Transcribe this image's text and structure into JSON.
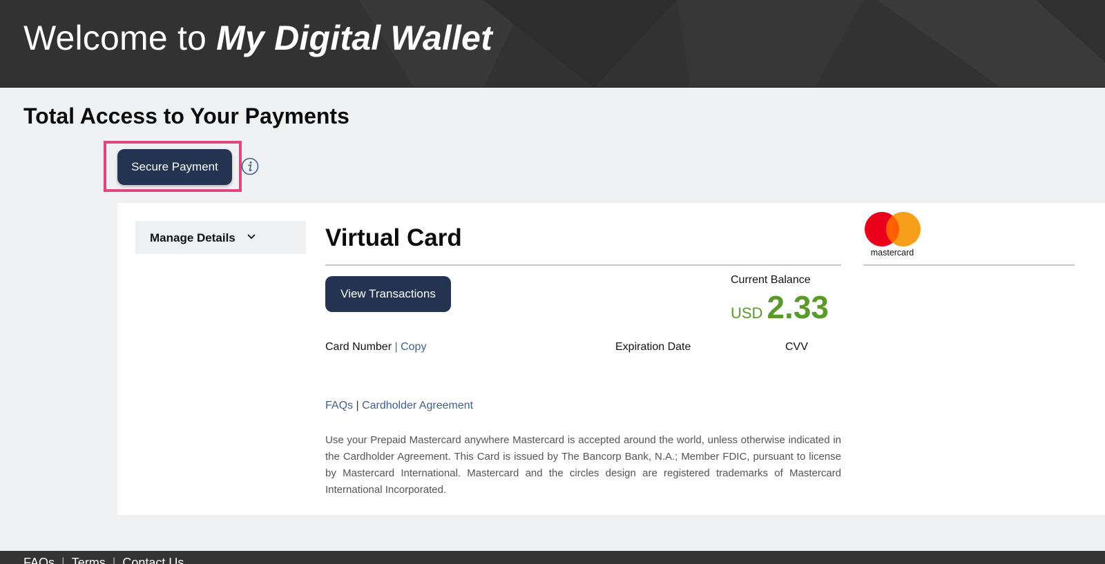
{
  "header": {
    "welcome_prefix": "Welcome to",
    "brand": "My Digital Wallet"
  },
  "page_title": "Total Access to Your Payments",
  "actions": {
    "secure_payment_label": "Secure Payment",
    "info_icon": "info-icon"
  },
  "sidebar": {
    "manage_details_label": "Manage Details",
    "chevron_icon": "chevron-down-icon"
  },
  "card": {
    "title": "Virtual Card",
    "view_transactions_label": "View Transactions",
    "balance_label": "Current Balance",
    "currency": "USD",
    "balance": "2.33",
    "card_number_label": "Card Number",
    "copy_link": "Copy",
    "expiration_label": "Expiration Date",
    "cvv_label": "CVV",
    "faqs_link": "FAQs",
    "cardholder_agreement_link": "Cardholder Agreement",
    "disclaimer": "Use your Prepaid Mastercard anywhere Mastercard is accepted around the world, unless otherwise indicated in the Cardholder Agreement. This Card is issued by The Bancorp Bank, N.A.; Member FDIC, pursuant to license by Mastercard International. Mastercard and the circles design are registered trademarks of Mastercard International Incorporated.",
    "brand_logo_text": "mastercard"
  },
  "footer": {
    "links": [
      "FAQs",
      "Terms",
      "Contact Us"
    ]
  },
  "colors": {
    "header_bg": "#323232",
    "button_bg": "#243352",
    "balance_green": "#5a9a2c",
    "highlight_pink": "#e2467e",
    "link_blue": "#3f5f8c"
  }
}
